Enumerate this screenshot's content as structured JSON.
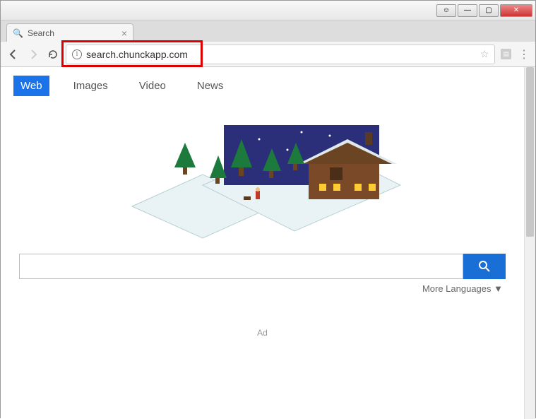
{
  "window": {
    "user_glyph": "☺",
    "minimize": "—",
    "maximize": "▢",
    "close": "✕"
  },
  "browser": {
    "tab": {
      "favicon": "🔍",
      "title": "Search",
      "close": "×"
    },
    "omnibox": {
      "url": "search.chunckapp.com"
    }
  },
  "page": {
    "tabs": {
      "web": "Web",
      "images": "Images",
      "video": "Video",
      "news": "News"
    },
    "search": {
      "value": ""
    },
    "more_languages": "More Languages ▼",
    "ad": "Ad"
  }
}
